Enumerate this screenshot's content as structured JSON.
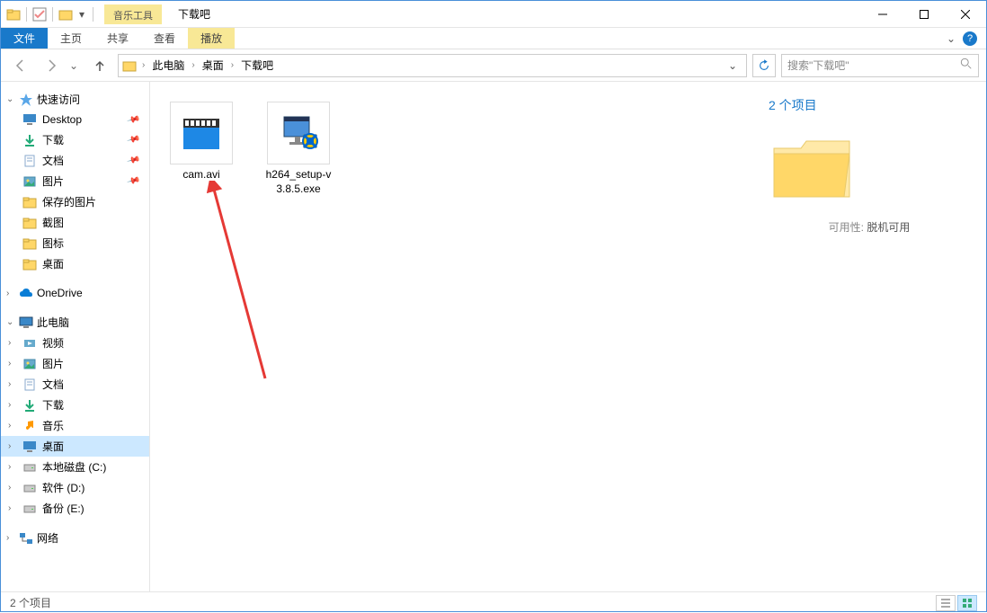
{
  "titlebar": {
    "contextual_tab": "音乐工具",
    "window_title": "下载吧"
  },
  "ribbon": {
    "file": "文件",
    "tabs": [
      "主页",
      "共享",
      "查看"
    ],
    "contextual": "播放"
  },
  "addressbar": {
    "crumbs": [
      "此电脑",
      "桌面",
      "下载吧"
    ],
    "search_placeholder": "搜索\"下载吧\""
  },
  "nav": {
    "quick_access": {
      "label": "快速访问",
      "items": [
        {
          "label": "Desktop",
          "pinned": true,
          "icon": "desktop"
        },
        {
          "label": "下载",
          "pinned": true,
          "icon": "downloads"
        },
        {
          "label": "文档",
          "pinned": true,
          "icon": "documents"
        },
        {
          "label": "图片",
          "pinned": true,
          "icon": "pictures"
        },
        {
          "label": "保存的图片",
          "pinned": false,
          "icon": "folder"
        },
        {
          "label": "截图",
          "pinned": false,
          "icon": "folder"
        },
        {
          "label": "图标",
          "pinned": false,
          "icon": "folder"
        },
        {
          "label": "桌面",
          "pinned": false,
          "icon": "folder"
        }
      ]
    },
    "onedrive": {
      "label": "OneDrive"
    },
    "this_pc": {
      "label": "此电脑",
      "items": [
        {
          "label": "视频",
          "icon": "videos"
        },
        {
          "label": "图片",
          "icon": "pictures"
        },
        {
          "label": "文档",
          "icon": "documents"
        },
        {
          "label": "下载",
          "icon": "downloads"
        },
        {
          "label": "音乐",
          "icon": "music"
        },
        {
          "label": "桌面",
          "icon": "desktop",
          "selected": true
        },
        {
          "label": "本地磁盘 (C:)",
          "icon": "disk"
        },
        {
          "label": "软件 (D:)",
          "icon": "disk"
        },
        {
          "label": "备份 (E:)",
          "icon": "disk"
        }
      ]
    },
    "network": {
      "label": "网络"
    }
  },
  "files": [
    {
      "name": "cam.avi",
      "type": "video"
    },
    {
      "name": "h264_setup-v3.8.5.exe",
      "type": "installer"
    }
  ],
  "details": {
    "title": "2 个项目",
    "avail_label": "可用性:",
    "avail_value": "脱机可用"
  },
  "statusbar": {
    "count": "2 个项目"
  }
}
